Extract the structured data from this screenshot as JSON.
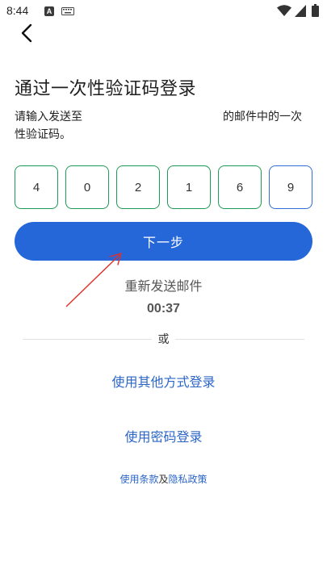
{
  "status_bar": {
    "time": "8:44",
    "notification_letter": "A",
    "icons": [
      "a-notification-icon",
      "keyboard-icon",
      "wifi-icon",
      "signal-icon",
      "battery-icon"
    ]
  },
  "header": {
    "back_icon": "chevron-left-icon"
  },
  "main": {
    "title": "通过一次性验证码登录",
    "description_part1": "请输入发送至",
    "description_part2": "的邮件中的一次",
    "description_line2": "性验证码。",
    "otp_digits": [
      "4",
      "0",
      "2",
      "1",
      "6",
      "9"
    ],
    "next_label": "下一步",
    "resend_label": "重新发送邮件",
    "countdown": "00:37",
    "or_label": "或",
    "alt_login_label": "使用其他方式登录",
    "password_login_label": "使用密码登录"
  },
  "footer": {
    "terms_label": "使用条款",
    "and_label": "及",
    "privacy_label": "隐私政策"
  },
  "colors": {
    "primary": "#2567d9",
    "otp_border": "#1d9a56",
    "otp_active_border": "#2f6fd6",
    "link": "#2b66c7",
    "annotation_arrow": "#e0302a"
  }
}
